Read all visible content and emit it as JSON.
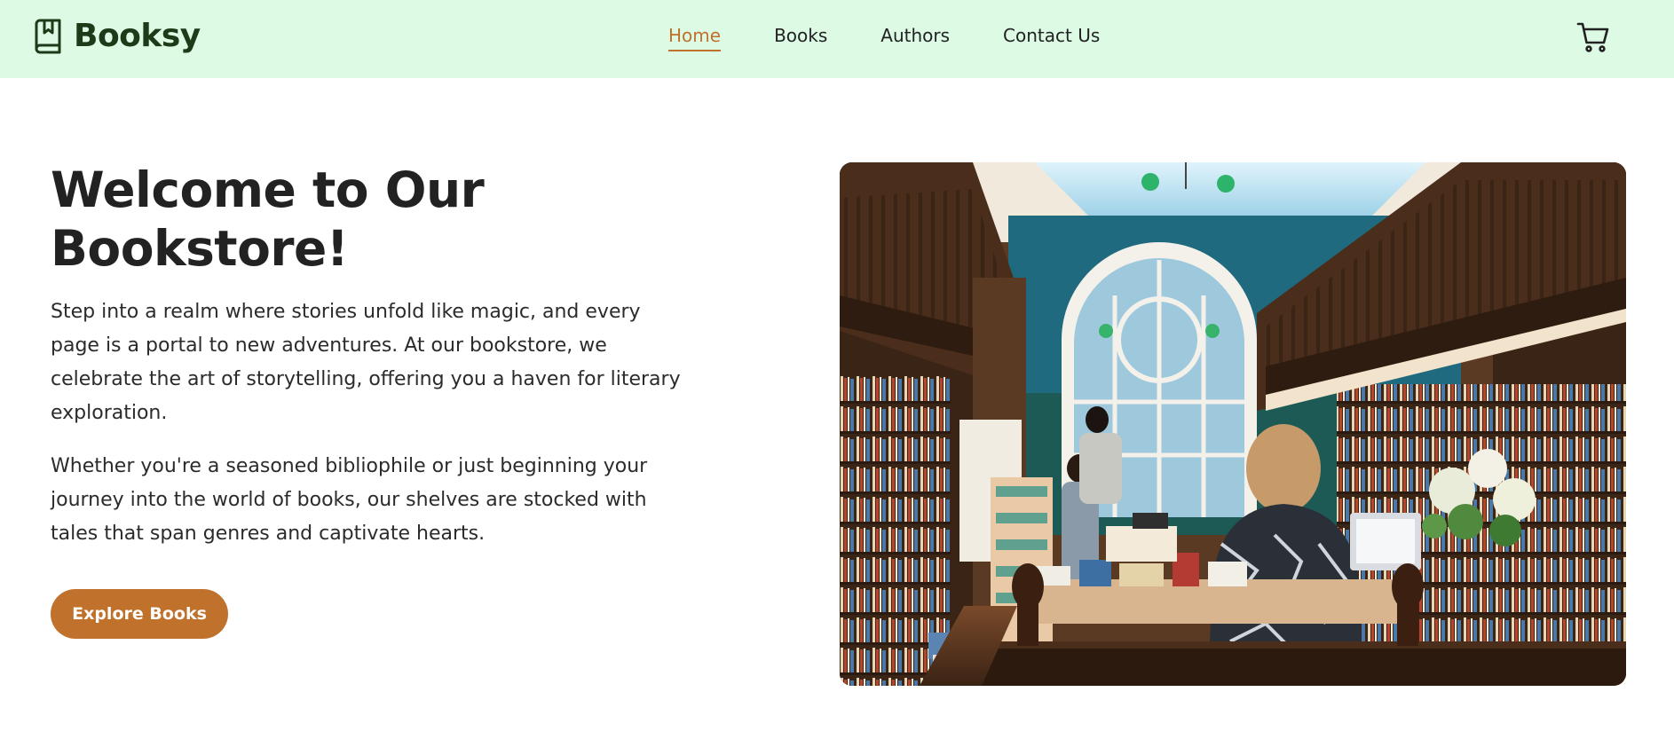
{
  "brand": {
    "name": "Booksy",
    "icon": "book-bookmark-icon"
  },
  "nav": {
    "items": [
      {
        "label": "Home",
        "active": true
      },
      {
        "label": "Books",
        "active": false
      },
      {
        "label": "Authors",
        "active": false
      },
      {
        "label": "Contact Us",
        "active": false
      }
    ]
  },
  "cart": {
    "icon": "shopping-cart-icon"
  },
  "hero": {
    "title": "Welcome to Our Bookstore!",
    "paragraphs": [
      "Step into a realm where stories unfold like magic, and every page is a portal to new adventures. At our bookstore, we celebrate the art of storytelling, offering you a haven for literary exploration.",
      "Whether you're a seasoned bibliophile or just beginning your journey into the world of books, our shelves are stocked with tales that span genres and captivate hearts."
    ],
    "cta_label": "Explore Books",
    "image_subject": "bookstore interior photo"
  },
  "colors": {
    "header_bg": "#dcfae4",
    "brand_text": "#1d3a19",
    "accent": "#c0712c",
    "text": "#222222",
    "background": "#ffffff"
  }
}
